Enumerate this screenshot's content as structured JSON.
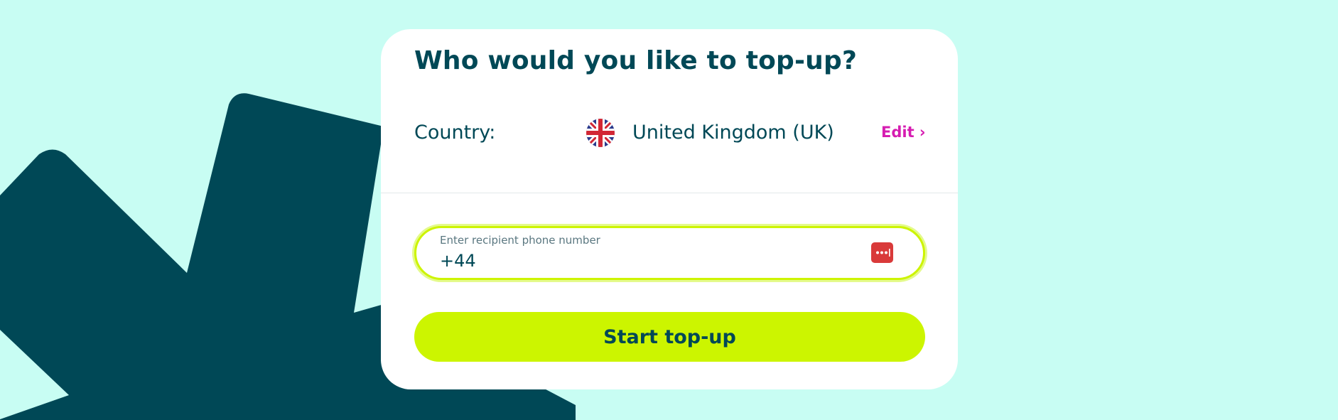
{
  "colors": {
    "background": "#c8fdf3",
    "brand_dark": "#004856",
    "accent_lime": "#ccf500",
    "edit_magenta": "#d61db1",
    "password_icon_red": "#d93a3a"
  },
  "card": {
    "title": "Who would you like to top-up?",
    "country": {
      "label": "Country:",
      "flag_icon": "uk-flag-icon",
      "name": "United Kingdom (UK)",
      "edit_label": "Edit ›"
    },
    "phone": {
      "placeholder_label": "Enter recipient phone number",
      "value": "+44",
      "password_manager_icon": "password-manager-icon"
    },
    "start_button_label": "Start top-up"
  }
}
